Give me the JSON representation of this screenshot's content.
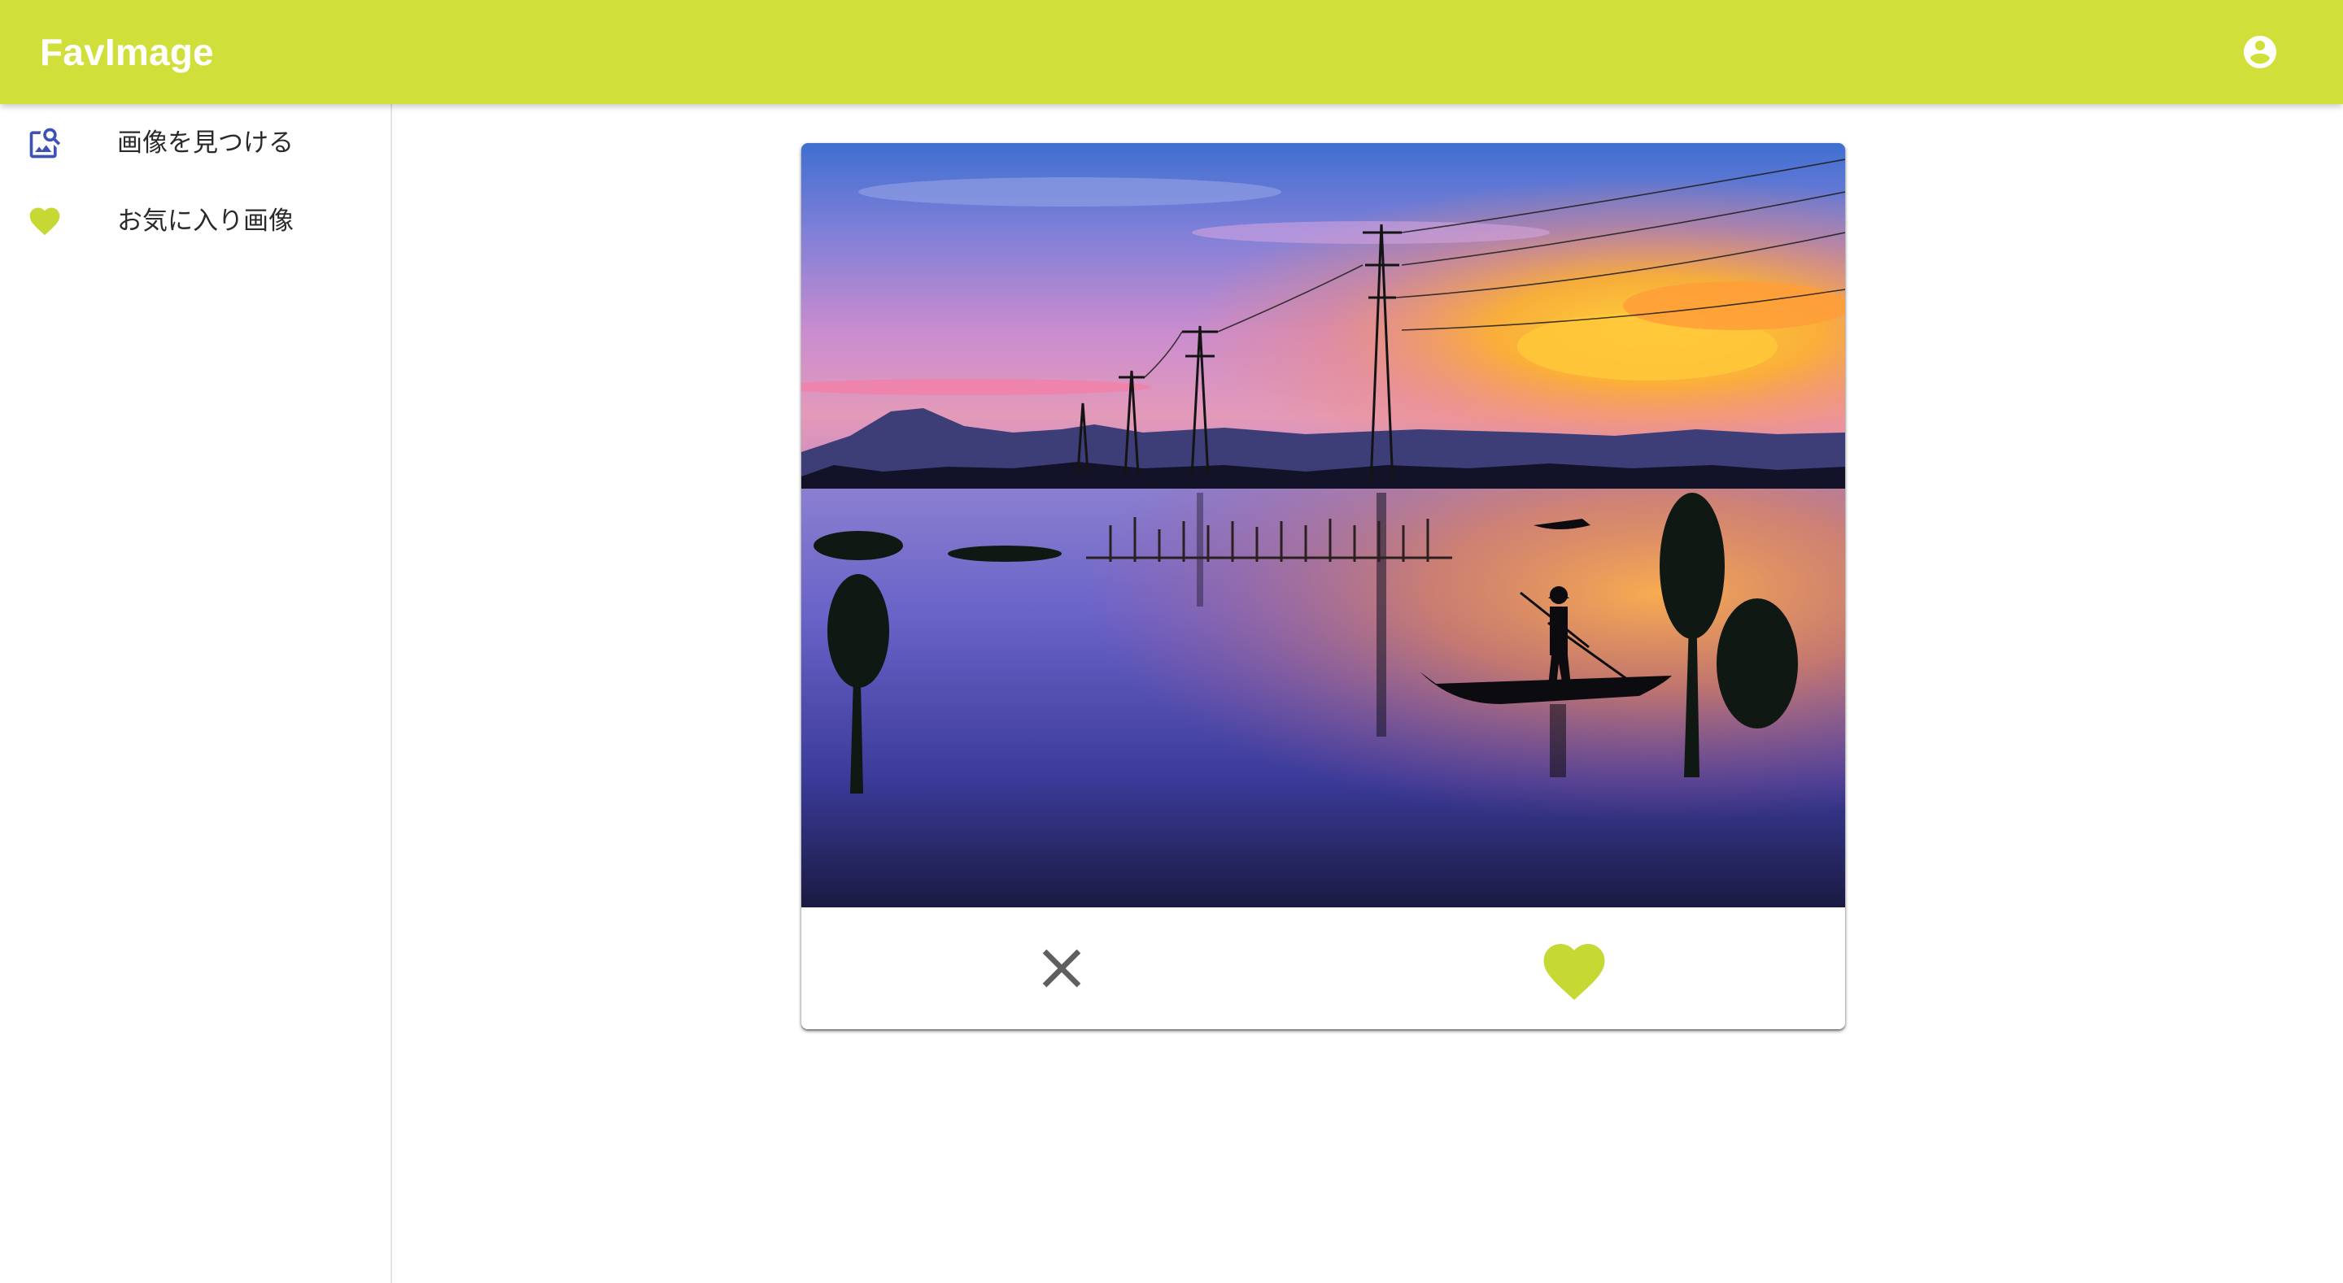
{
  "app": {
    "title": "FavImage"
  },
  "header": {
    "account_icon": "account-circle-icon"
  },
  "sidebar": {
    "items": [
      {
        "label": "画像を見つける",
        "icon": "image-search-icon",
        "icon_color": "#3f51b5"
      },
      {
        "label": "お気に入り画像",
        "icon": "heart-icon",
        "icon_color": "#c6d834"
      }
    ]
  },
  "card": {
    "image_subject": "sunset-lake-fisherman-power-lines",
    "actions": {
      "dismiss_icon": "close-icon",
      "like_icon": "heart-icon"
    }
  },
  "colors": {
    "accent": "#d1df3a",
    "heart": "#c6d834",
    "nav_icon": "#3f51b5",
    "close_icon": "#5f5f5f"
  }
}
